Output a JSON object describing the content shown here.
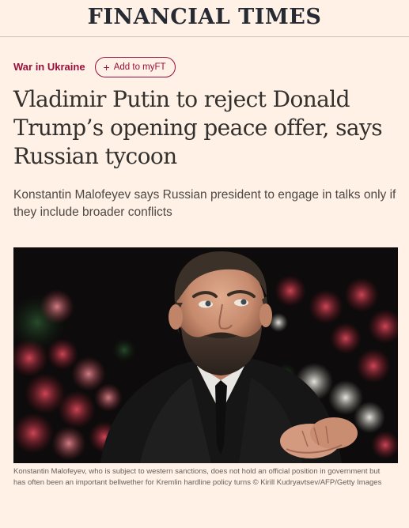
{
  "masthead": {
    "title": "FINANCIAL TIMES"
  },
  "topic": {
    "label": "War in Ukraine"
  },
  "myft": {
    "icon": "plus-icon",
    "label": "Add to myFT"
  },
  "article": {
    "headline": "Vladimir Putin to reject Donald Trump’s opening peace offer, says Russian tycoon",
    "standfirst": "Konstantin Malofeyev says Russian president to engage in talks only if they include broader conflicts"
  },
  "image": {
    "caption": "Konstantin Malofeyev, who is subject to western sanctions, does not hold an official position in government but has often been an important bellwether for Kremlin hardline policy turns © Kirill Kudryavtsev/AFP/Getty Images"
  },
  "colors": {
    "page_background": "#fff1e5",
    "accent": "#990f3d",
    "text": "#33302e"
  }
}
